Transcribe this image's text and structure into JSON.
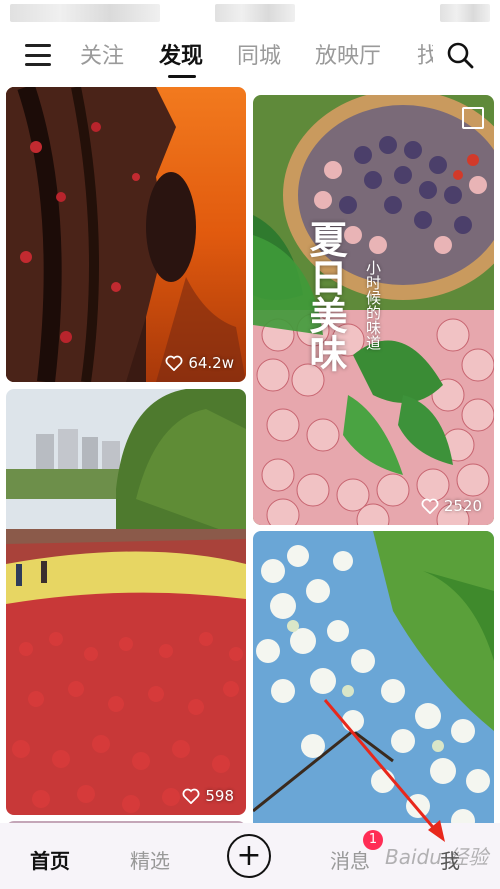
{
  "top_nav": {
    "tabs": [
      "关注",
      "发现",
      "同城",
      "放映厅",
      "找"
    ],
    "active_tab": "发现"
  },
  "feed": {
    "cards": [
      {
        "likes": "64.2w"
      },
      {
        "title": "夏日美味",
        "subtitle": "小时候的味道",
        "likes": "2520"
      },
      {
        "likes": "598"
      },
      {
        "likes": ""
      }
    ]
  },
  "bottom_nav": {
    "home": "首页",
    "featured": "精选",
    "add": "+",
    "messages": "消息",
    "messages_badge": "1",
    "me": "我",
    "watermark": "Baidu 经验"
  },
  "colors": {
    "badge": "#ff2d55",
    "annotation_arrow": "#e8281c"
  }
}
